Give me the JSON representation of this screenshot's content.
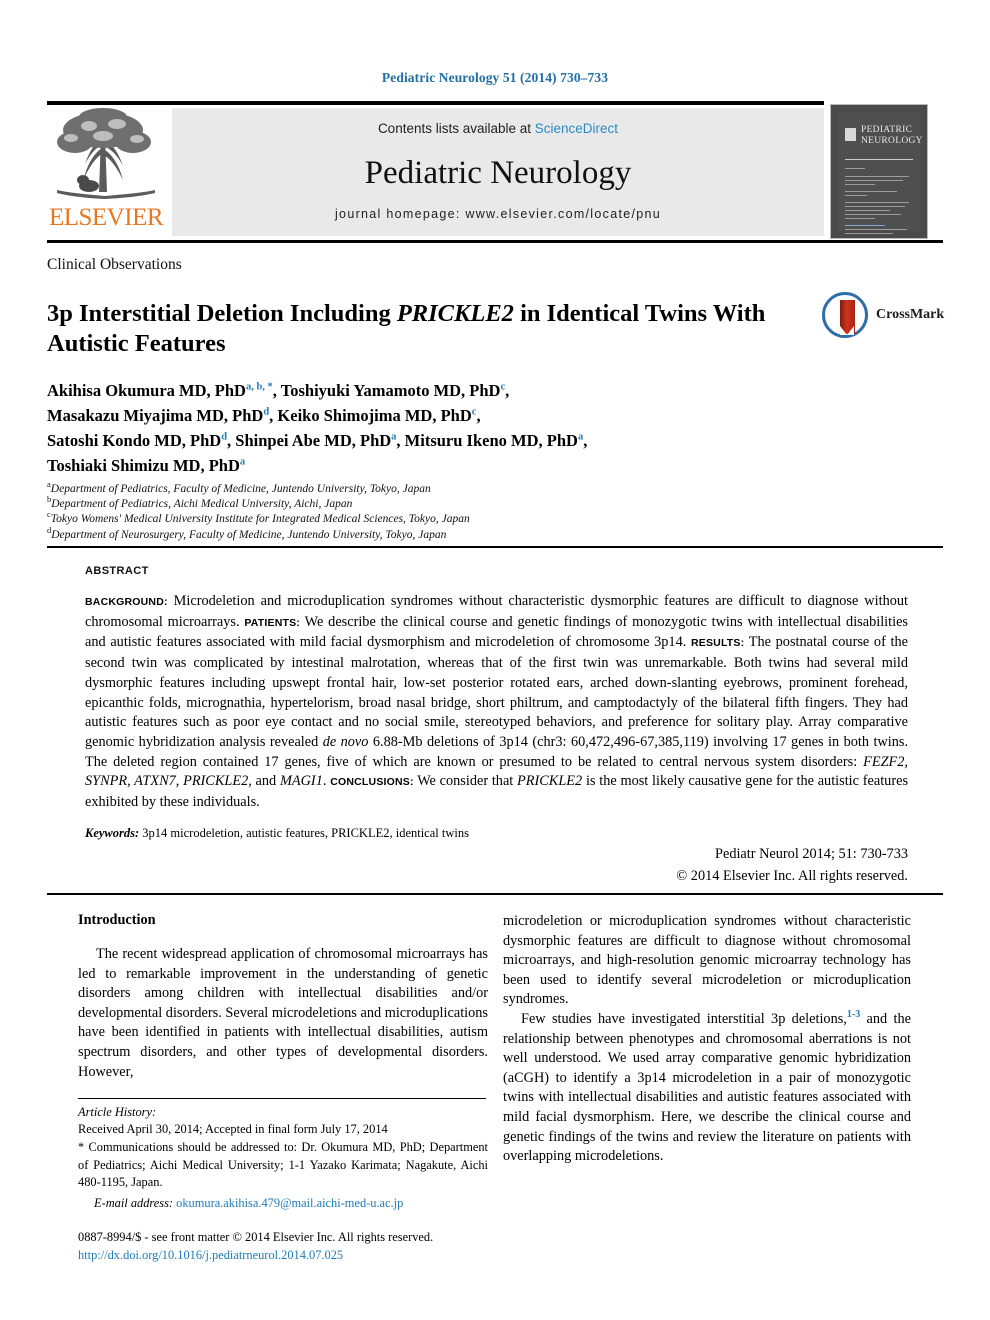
{
  "running_head": "Pediatric Neurology 51 (2014) 730–733",
  "masthead": {
    "contents_prefix": "Contents lists available at ",
    "contents_link": "ScienceDirect",
    "journal_title": "Pediatric Neurology",
    "homepage": "journal homepage: www.elsevier.com/locate/pnu",
    "publisher_logo_word": "ELSEVIER",
    "cover_title_line1": "PEDIATRIC",
    "cover_title_line2": "NEUROLOGY"
  },
  "article": {
    "kicker": "Clinical Observations",
    "title_part1": "3p Interstitial Deletion Including ",
    "title_italic": "PRICKLE2",
    "title_part2": " in Identical Twins With Autistic Features",
    "crossmark_label": "CrossMark",
    "authors_line1_a": "Akihisa Okumura MD, PhD",
    "authors_line1_sup1": "a, b, *",
    "authors_line1_b": ", Toshiyuki Yamamoto MD, PhD",
    "authors_line1_sup2": "c",
    "authors_line1_c": ",",
    "authors_line2_a": "Masakazu Miyajima MD, PhD",
    "authors_line2_sup1": "d",
    "authors_line2_b": ", Keiko Shimojima MD, PhD",
    "authors_line2_sup2": "c",
    "authors_line2_c": ",",
    "authors_line3_a": "Satoshi Kondo MD, PhD",
    "authors_line3_sup1": "d",
    "authors_line3_b": ", Shinpei Abe MD, PhD",
    "authors_line3_sup2": "a",
    "authors_line3_c": ", Mitsuru Ikeno MD, PhD",
    "authors_line3_sup3": "a",
    "authors_line3_d": ",",
    "authors_line4_a": "Toshiaki Shimizu MD, PhD",
    "authors_line4_sup1": "a",
    "affiliations": [
      {
        "marker": "a",
        "text": "Department of Pediatrics, Faculty of Medicine, Juntendo University, Tokyo, Japan"
      },
      {
        "marker": "b",
        "text": "Department of Pediatrics, Aichi Medical University, Aichi, Japan"
      },
      {
        "marker": "c",
        "text": "Tokyo Womens' Medical University Institute for Integrated Medical Sciences, Tokyo, Japan"
      },
      {
        "marker": "d",
        "text": "Department of Neurosurgery, Faculty of Medicine, Juntendo University, Tokyo, Japan"
      }
    ]
  },
  "abstract": {
    "label": "ABSTRACT",
    "bg_label": "BACKGROUND:",
    "bg_text": " Microdeletion and microduplication syndromes without characteristic dysmorphic features are difficult to diagnose without chromosomal microarrays. ",
    "pt_label": "PATIENTS:",
    "pt_text": " We describe the clinical course and genetic findings of monozygotic twins with intellectual disabilities and autistic features associated with mild facial dysmorphism and microdeletion of chromosome 3p14. ",
    "rs_label": "RESULTS:",
    "rs_text_a": " The postnatal course of the second twin was complicated by intestinal malrotation, whereas that of the first twin was unremarkable. Both twins had several mild dysmorphic features including upswept frontal hair, low-set posterior rotated ears, arched down-slanting eyebrows, prominent forehead, epicanthic folds, micrognathia, hypertelorism, broad nasal bridge, short philtrum, and camptodactyly of the bilateral fifth fingers. They had autistic features such as poor eye contact and no social smile, stereotyped behaviors, and preference for solitary play. Array comparative genomic hybridization analysis revealed ",
    "rs_italic_1": "de novo",
    "rs_text_b": " 6.88-Mb deletions of 3p14 (chr3: 60,472,496-67,385,119) involving 17 genes in both twins. The deleted region contained 17 genes, five of which are known or presumed to be related to central nervous system disorders: ",
    "rs_genes": "FEZF2, SYNPR, ATXN7, PRICKLE2,",
    "rs_text_c": " and ",
    "rs_gene_last": "MAGI1",
    "rs_text_d": ". ",
    "cl_label": "CONCLUSIONS:",
    "cl_text_a": " We consider that ",
    "cl_italic": "PRICKLE2",
    "cl_text_b": " is the most likely causative gene for the autistic features exhibited by these individuals.",
    "keywords_label": "Keywords:",
    "keywords_text": " 3p14 microdeletion, autistic features, PRICKLE2, identical twins",
    "citation": "Pediatr Neurol 2014; 51: 730-733",
    "copyright": "© 2014 Elsevier Inc. All rights reserved."
  },
  "body": {
    "intro_heading": "Introduction",
    "left_para_1": "The recent widespread application of chromosomal microarrays has led to remarkable improvement in the understanding of genetic disorders among children with intellectual disabilities and/or developmental disorders. Several microdeletions and microduplications have been identified in patients with intellectual disabilities, autism spectrum disorders, and other types of developmental disorders. However,",
    "right_para_1": "microdeletion or microduplication syndromes without characteristic dysmorphic features are difficult to diagnose without chromosomal microarrays, and high-resolution genomic microarray technology has been used to identify several microdeletion or microduplication syndromes.",
    "right_para_2_a": "Few studies have investigated interstitial 3p deletions,",
    "right_para_2_ref": "1-3",
    "right_para_2_b": " and the relationship between phenotypes and chromosomal aberrations is not well understood. We used array comparative genomic hybridization (aCGH) to identify a 3p14 microdeletion in a pair of monozygotic twins with intellectual disabilities and autistic features associated with mild facial dysmorphism. Here, we describe the clinical course and genetic findings of the twins and review the literature on patients with overlapping microdeletions."
  },
  "footnotes": {
    "article_history_label": "Article History:",
    "article_history_text": "Received April 30, 2014; Accepted in final form July 17, 2014",
    "correspondence": "* Communications should be addressed to: Dr. Okumura MD, PhD; Department of Pediatrics; Aichi Medical University; 1-1 Yazako Karimata; Nagakute, Aichi 480-1195, Japan.",
    "email_label": "E-mail address:",
    "email_value": " okumura.akihisa.479@mail.aichi-med-u.ac.jp",
    "issn_line": "0887-8994/$ - see front matter © 2014 Elsevier Inc. All rights reserved.",
    "doi_line": "http://dx.doi.org/10.1016/j.pediatrneurol.2014.07.025"
  },
  "colors": {
    "link_blue": "#1f7bb6",
    "sciencedirect_blue": "#2b8bc4",
    "elsevier_orange": "#e87722",
    "crossmark_blue": "#2f6ea8",
    "crossmark_red": "#d0331c"
  }
}
